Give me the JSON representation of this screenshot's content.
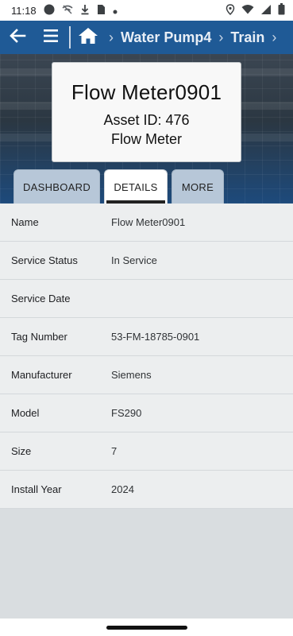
{
  "status_bar": {
    "time": "11:18",
    "icons": [
      "circle-notification-icon",
      "wifi-slash-icon",
      "download-icon",
      "sim-card-icon",
      "dot-icon",
      "location-icon",
      "wifi-icon",
      "signal-icon",
      "battery-icon"
    ]
  },
  "app_bar": {
    "breadcrumbs": [
      "Water Pump4",
      "Train"
    ],
    "icons": [
      "back-arrow-icon",
      "hamburger-menu-icon",
      "home-icon",
      "chevron-right-icon"
    ],
    "color": "#1f5a96"
  },
  "asset": {
    "name": "Flow Meter0901",
    "asset_id_line": "Asset ID: 476",
    "type": "Flow Meter"
  },
  "tabs": [
    {
      "label": "DASHBOARD",
      "active": false
    },
    {
      "label": "DETAILS",
      "active": true
    },
    {
      "label": "MORE",
      "active": false
    }
  ],
  "details": [
    {
      "label": "Name",
      "value": "Flow Meter0901"
    },
    {
      "label": "Service Status",
      "value": "In Service"
    },
    {
      "label": "Service Date",
      "value": ""
    },
    {
      "label": "Tag Number",
      "value": "53-FM-18785-0901"
    },
    {
      "label": "Manufacturer",
      "value": "Siemens"
    },
    {
      "label": "Model",
      "value": "FS290"
    },
    {
      "label": "Size",
      "value": "7"
    },
    {
      "label": "Install Year",
      "value": "2024"
    }
  ]
}
